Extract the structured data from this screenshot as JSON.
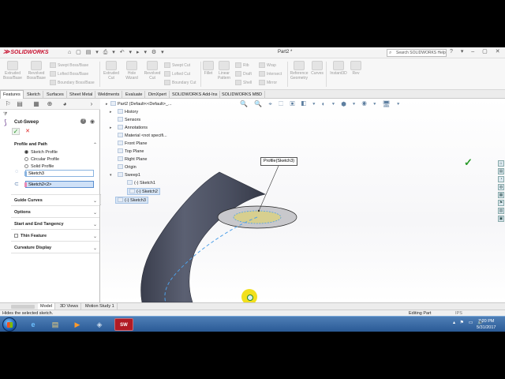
{
  "app": {
    "brand": "SOLIDWORKS",
    "doc_title": "Part2 *",
    "search_placeholder": "Search SOLIDWORKS Help",
    "quick_access": "⌂ ▢ ▤ ▾ ⎙ ▾ ↶ ▾ ▸ ▾ ⚙ ▾",
    "window_controls": "? ▾ – ▢ ✕"
  },
  "ribbon": {
    "extruded_boss": "Extruded Boss/Base",
    "revolved_boss": "Revolved Boss/Base",
    "swept_boss": "Swept Boss/Base",
    "lofted_boss": "Lofted Boss/Base",
    "boundary_boss": "Boundary Boss/Base",
    "extruded_cut": "Extruded Cut",
    "hole_wizard": "Hole Wizard",
    "revolved_cut": "Revolved Cut",
    "swept_cut": "Swept Cut",
    "lofted_cut": "Lofted Cut",
    "boundary_cut": "Boundary Cut",
    "fillet": "Fillet",
    "linear_pattern": "Linear Pattern",
    "rib": "Rib",
    "draft": "Draft",
    "shell": "Shell",
    "wrap": "Wrap",
    "intersect": "Intersect",
    "mirror": "Mirror",
    "reference_geometry": "Reference Geometry",
    "curves": "Curves",
    "instant3d": "Instant3D",
    "rev": "Rev"
  },
  "tabs": [
    "Features",
    "Sketch",
    "Surfaces",
    "Sheet Metal",
    "Weldments",
    "Evaluate",
    "DimXpert",
    "SOLIDWORKS Add-Ins",
    "SOLIDWORKS MBD"
  ],
  "property_manager": {
    "title": "Cut-Sweep",
    "help": "?",
    "ok": "✓",
    "cancel": "✕",
    "profile_and_path": "Profile and Path",
    "options_radio": [
      "Sketch Profile",
      "Circular Profile",
      "Solid Profile"
    ],
    "selected_radio": "Sketch Profile",
    "profile_value": "Sketch3",
    "path_value": "Sketch2<2>",
    "guide_curves": "Guide Curves",
    "options": "Options",
    "start_end_tangency": "Start and End Tangency",
    "thin_feature": "Thin Feature",
    "curvature_display": "Curvature Display"
  },
  "feature_tree": {
    "root": "Part2  (Default<<Default>_...",
    "items": [
      "History",
      "Sensors",
      "Annotations",
      "Material <not specifi...",
      "Front Plane",
      "Top Plane",
      "Right Plane",
      "Origin",
      "Sweep1"
    ],
    "sweep_children": [
      "(-) Sketch1",
      "(-) Sketch2"
    ],
    "selected": "(-) Sketch3"
  },
  "viewport": {
    "tooltip": "Profile(Sketch3)",
    "hud": "🔍 🔍 ⌖ ⬚ ▣ ◧ ▾ ◐ ▾ ⬢ ▾ ◉ ▾ 🖥 ▾",
    "side_strip": [
      "⌂",
      "▤",
      "◔",
      "◍",
      "▦",
      "⚑",
      "▥",
      "▣"
    ],
    "model_color": "#4a4f5e",
    "profile_color": "#d7cf8f",
    "path_color": "#4ea0e8"
  },
  "bottom_tabs": [
    "Model",
    "3D Views",
    "Motion Study 1"
  ],
  "status": {
    "message": "Hides the selected sketch.",
    "mode": "Editing Part",
    "units": "IPS"
  },
  "taskbar": {
    "apps": [
      "e",
      "▤",
      "▶",
      "◈",
      "SW"
    ],
    "tray": "▴ ⚑ ▭ 🔊",
    "time": "7:20 PM",
    "date": "5/31/2017"
  }
}
